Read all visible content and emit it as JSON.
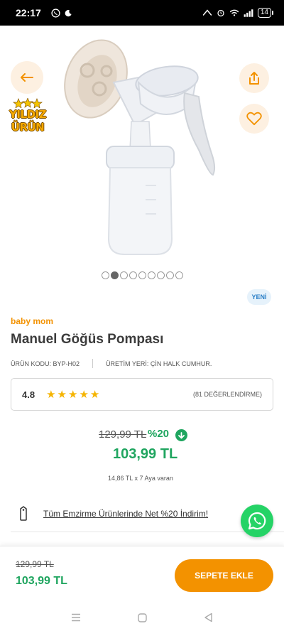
{
  "status_bar": {
    "time": "22:17",
    "battery": "14"
  },
  "header": {
    "badge_line1": "YILDIZ",
    "badge_line2": "ÜRÜN"
  },
  "carousel": {
    "dot_count": 9,
    "active_index": 1
  },
  "product": {
    "new_label": "YENİ",
    "brand": "baby mom",
    "title": "Manuel Göğüs Pompası",
    "code": "ÜRÜN KODU: BYP-H02",
    "origin": "ÜRETİM YERİ: ÇİN HALK CUMHUR.",
    "rating_score": "4.8",
    "rating_stars": 5,
    "rating_count": "(81 DEĞERLENDİRME)"
  },
  "pricing": {
    "old_price": "129,99 TL",
    "discount": "%20",
    "new_price": "103,99 TL",
    "installment": "14,86 TL x 7 Aya varan"
  },
  "promo": {
    "text": "Tüm Emzirme Ürünlerinde Net %20 İndirim!"
  },
  "bottom_bar": {
    "old_price": "129,99 TL",
    "new_price": "103,99 TL",
    "add_to_cart": "SEPETE EKLE"
  },
  "colors": {
    "accent_orange": "#f39200",
    "price_green": "#1fa55f",
    "star_yellow": "#f5b400",
    "whatsapp": "#25d366"
  },
  "icons": [
    "whatsapp-status-icon",
    "moon-icon",
    "back-arrow-icon",
    "share-icon",
    "heart-icon",
    "star-icon",
    "arrow-down-icon",
    "tag-icon",
    "whatsapp-icon",
    "menu-nav-icon",
    "home-nav-icon",
    "back-nav-icon"
  ]
}
